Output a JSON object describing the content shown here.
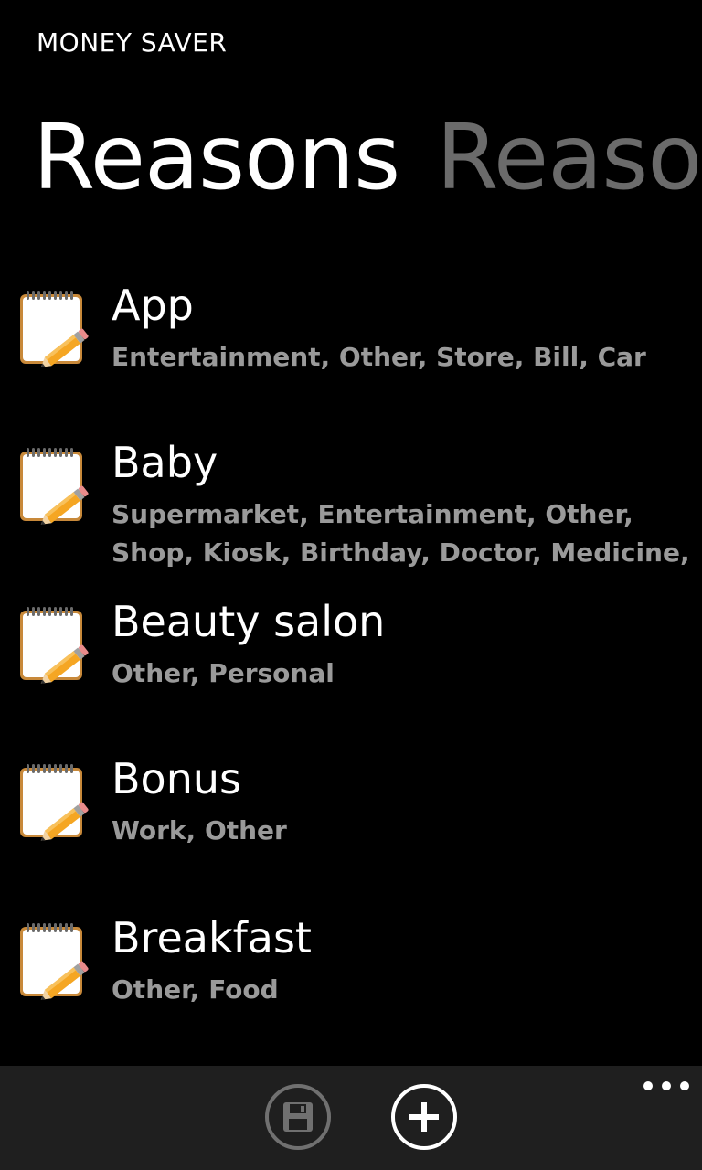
{
  "app": {
    "title": "MONEY SAVER"
  },
  "pivot": {
    "items": [
      {
        "label": "Reasons",
        "active": true
      },
      {
        "label": "Reasons",
        "active": false
      }
    ]
  },
  "reasons": [
    {
      "title": "App",
      "subtitle": "Entertainment, Other, Store, Bill, Car",
      "icon": "notepad-pencil-icon"
    },
    {
      "title": "Baby",
      "subtitle": "Supermarket, Entertainment, Other, Shop, Kiosk, Birthday, Doctor, Medicine,",
      "icon": "notepad-pencil-icon"
    },
    {
      "title": "Beauty salon",
      "subtitle": "Other, Personal",
      "icon": "notepad-pencil-icon"
    },
    {
      "title": "Bonus",
      "subtitle": "Work, Other",
      "icon": "notepad-pencil-icon"
    },
    {
      "title": "Breakfast",
      "subtitle": "Other, Food",
      "icon": "notepad-pencil-icon"
    }
  ],
  "app_bar": {
    "buttons": [
      {
        "icon": "save-icon",
        "enabled": false
      },
      {
        "icon": "add-icon",
        "enabled": true
      }
    ],
    "more_icon": "ellipsis-icon"
  },
  "colors": {
    "background": "#000000",
    "title_text": "#ffffff",
    "subtitle_text": "#9a9a9a",
    "inactive_pivot": "#6b6b6b",
    "app_bar": "#1f1f1f"
  }
}
